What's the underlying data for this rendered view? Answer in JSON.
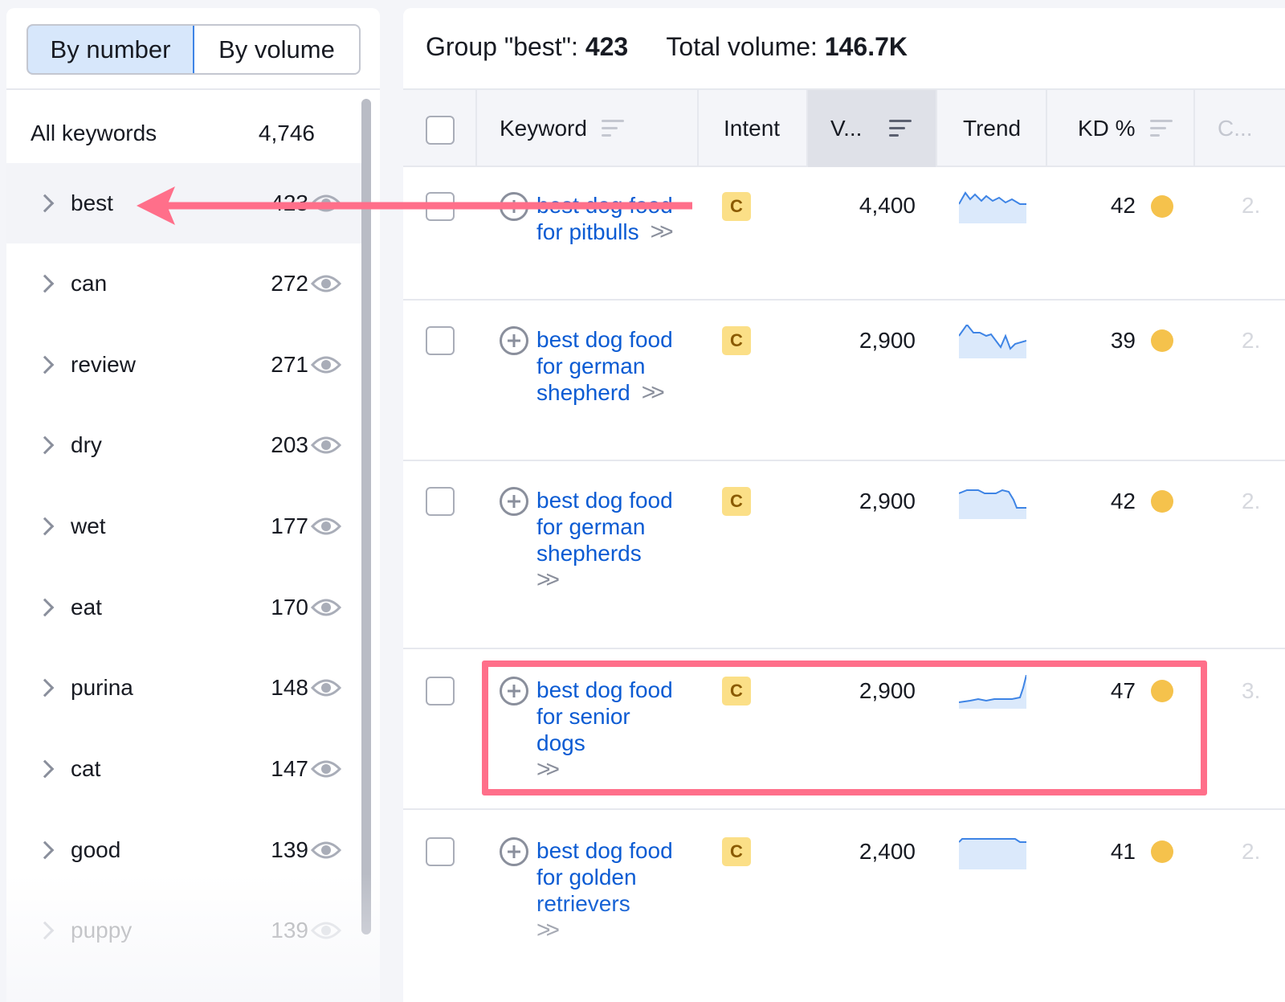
{
  "toggle": {
    "by_number": "By number",
    "by_volume": "By volume"
  },
  "sidebar": {
    "all_label": "All keywords",
    "all_count": "4,746",
    "groups": [
      {
        "name": "best",
        "count": "423"
      },
      {
        "name": "can",
        "count": "272"
      },
      {
        "name": "review",
        "count": "271"
      },
      {
        "name": "dry",
        "count": "203"
      },
      {
        "name": "wet",
        "count": "177"
      },
      {
        "name": "eat",
        "count": "170"
      },
      {
        "name": "purina",
        "count": "148"
      },
      {
        "name": "cat",
        "count": "147"
      },
      {
        "name": "good",
        "count": "139"
      },
      {
        "name": "puppy",
        "count": "139"
      }
    ]
  },
  "summary": {
    "group_label": "Group \"best\":",
    "group_count": "423",
    "volume_label": "Total volume:",
    "volume_value": "146.7K"
  },
  "table": {
    "headers": {
      "keyword": "Keyword",
      "intent": "Intent",
      "volume": "V...",
      "trend": "Trend",
      "kd": "KD %",
      "cpc": "C..."
    },
    "rows": [
      {
        "keyword": "best dog food for pitbulls",
        "intent": "C",
        "volume": "4,400",
        "kd": "42",
        "cpc": "2."
      },
      {
        "keyword": "best dog food for german shepherd",
        "intent": "C",
        "volume": "2,900",
        "kd": "39",
        "cpc": "2."
      },
      {
        "keyword": "best dog food for german shepherds",
        "intent": "C",
        "volume": "2,900",
        "kd": "42",
        "cpc": "2."
      },
      {
        "keyword": "best dog food for senior dogs",
        "intent": "C",
        "volume": "2,900",
        "kd": "47",
        "cpc": "3."
      },
      {
        "keyword": "best dog food for golden retrievers",
        "intent": "C",
        "volume": "2,400",
        "kd": "41",
        "cpc": "2."
      }
    ]
  },
  "colors": {
    "accent": "#3e84e5",
    "link": "#0b5bd3",
    "highlight": "#ff6f8a",
    "kd_dot": "#f5c24c",
    "intent_badge": "#fbdf87"
  }
}
